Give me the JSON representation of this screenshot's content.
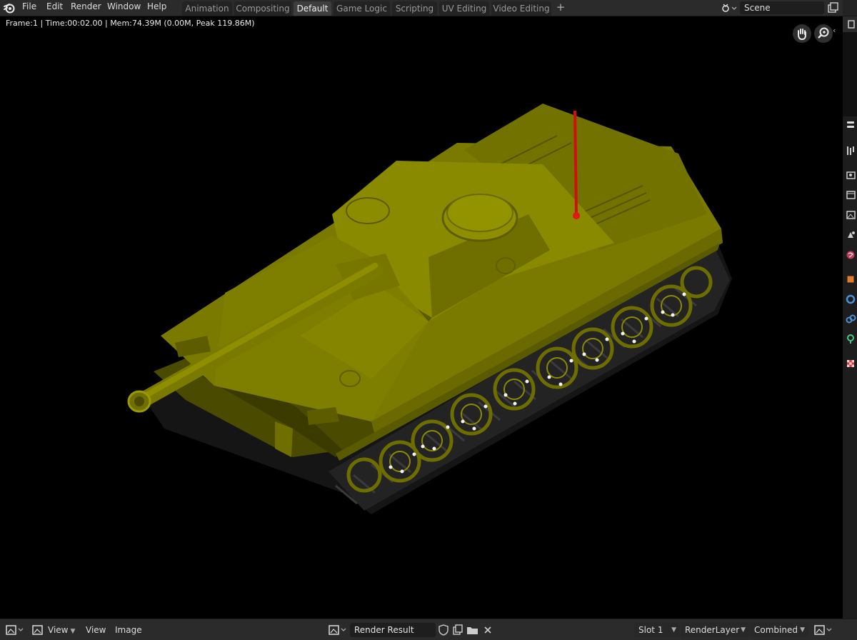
{
  "menu": [
    "File",
    "Edit",
    "Render",
    "Window",
    "Help"
  ],
  "workspace_tabs": [
    {
      "label": "Animation",
      "active": false
    },
    {
      "label": "Compositing",
      "active": false
    },
    {
      "label": "Default",
      "active": true
    },
    {
      "label": "Game Logic",
      "active": false
    },
    {
      "label": "Scripting",
      "active": false
    },
    {
      "label": "UV Editing",
      "active": false
    },
    {
      "label": "Video Editing",
      "active": false
    }
  ],
  "add_tab": "+",
  "scene": {
    "name": "Scene"
  },
  "viewport": {
    "stats": "Frame:1 | Time:00:02.00 | Mem:74.39M (0.00M, Peak 119.86M)",
    "nav_icons": [
      "hand-pan-icon",
      "zoom-icon"
    ]
  },
  "properties_tabs": [
    "tool-icon",
    "render-icon",
    "output-icon",
    "view-layer-icon",
    "scene-icon",
    "world-icon",
    "object-icon",
    "modifiers-icon",
    "particles-icon",
    "physics-icon",
    "texture-icon"
  ],
  "bottom_bar": {
    "view_menu_1": "View",
    "view_menu_2": "View",
    "image_menu": "Image",
    "image_name": "Render Result",
    "slot": "Slot 1",
    "render_layer": "RenderLayer",
    "pass": "Combined"
  },
  "colors": {
    "tank_body": "#8a8a00",
    "track": "#1a1a1a",
    "antenna": "#d01010",
    "active_tab": "#3e3e3e"
  }
}
